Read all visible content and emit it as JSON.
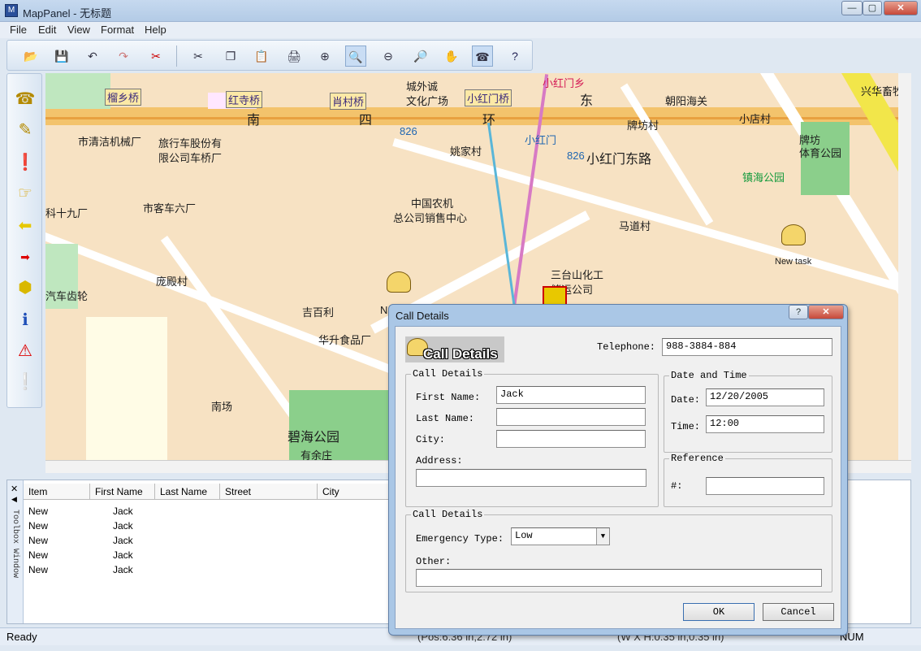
{
  "window": {
    "title": "MapPanel - 无标题",
    "min": "—",
    "max": "▢",
    "close": "✕"
  },
  "menu": [
    "File",
    "Edit",
    "View",
    "Format",
    "Help"
  ],
  "toolbar_icons": [
    "open-icon",
    "save-icon",
    "undo-icon",
    "redo-icon",
    "crop-icon",
    "cut-icon",
    "copy-icon",
    "paste-icon",
    "print-icon",
    "zoom-in-icon",
    "zoom-window-icon",
    "zoom-out-icon",
    "zoom-extent-icon",
    "pan-hand-icon",
    "phone-call-icon",
    "help-icon"
  ],
  "map": {
    "labels": {
      "l1": "榴乡桥",
      "l2": "红寺桥",
      "l3": "肖村桥",
      "l4": "小红门桥",
      "l5": "城外诚",
      "l6": "文化广场",
      "l7": "小红门乡",
      "l8": "朝阳海关",
      "l9": "南",
      "l10": "四",
      "l11": "环",
      "l12": "东",
      "l13": "市清洁机械厂",
      "l14": "旅行车股份有",
      "l15": "限公司车桥厂",
      "l16": "姚家村",
      "l17": "小红门东路",
      "l18": "牌坊村",
      "l19": "小店村",
      "l20": "牌坊",
      "l21": "体育公园",
      "l22": "镇海公园",
      "l23": "科十九厂",
      "l24": "市客车六厂",
      "l25": "中国农机",
      "l26": "总公司销售中心",
      "l27": "马道村",
      "l28": "庞殿村",
      "l29": "三台山化工",
      "l30": "储运公司",
      "l31": "汽车齿轮",
      "l32": "吉百利",
      "l33": "华升食品厂",
      "l34": "南场",
      "l35": "碧海公园",
      "l36": "有余庄",
      "l37": "兴华畜牧",
      "l38": "N",
      "l39": "826",
      "l40": "826",
      "l41": "小红门"
    },
    "new_task_label": "New task"
  },
  "toolbox_window_label": "Toolbox Window",
  "list": {
    "headers": [
      "Item",
      "First Name",
      "Last Name",
      "Street",
      "City"
    ],
    "rows": [
      {
        "item": "New",
        "first": "Jack"
      },
      {
        "item": "New",
        "first": "Jack"
      },
      {
        "item": "New",
        "first": "Jack"
      },
      {
        "item": "New",
        "first": "Jack"
      },
      {
        "item": "New",
        "first": "Jack"
      }
    ]
  },
  "status": {
    "ready": "Ready",
    "pos": "(Pos:6.36 in,2.72 in)",
    "size": "(W X H:0.35 in,0.35 in)",
    "num": "NUM"
  },
  "dialog": {
    "title": "Call Details",
    "help": "?",
    "close": "✕",
    "banner": "Call Details",
    "telephone_label": "Telephone:",
    "telephone_value": "988-3884-884",
    "call_group": "Call Details",
    "first_name_label": "First Name:",
    "first_name_value": "Jack",
    "last_name_label": "Last Name:",
    "last_name_value": "",
    "city_label": "City:",
    "city_value": "",
    "address_label": "Address:",
    "address_value": "",
    "date_group": "Date and Time",
    "date_label": "Date:",
    "date_value": "12/20/2005",
    "time_label": "Time:",
    "time_value": "12:00",
    "reference_group": "Reference",
    "ref_label": "#:",
    "ref_value": "",
    "call_group2": "Call Details",
    "emergency_label": "Emergency Type:",
    "emergency_value": "Low",
    "other_label": "Other:",
    "other_value": "",
    "ok": "OK",
    "cancel": "Cancel"
  }
}
